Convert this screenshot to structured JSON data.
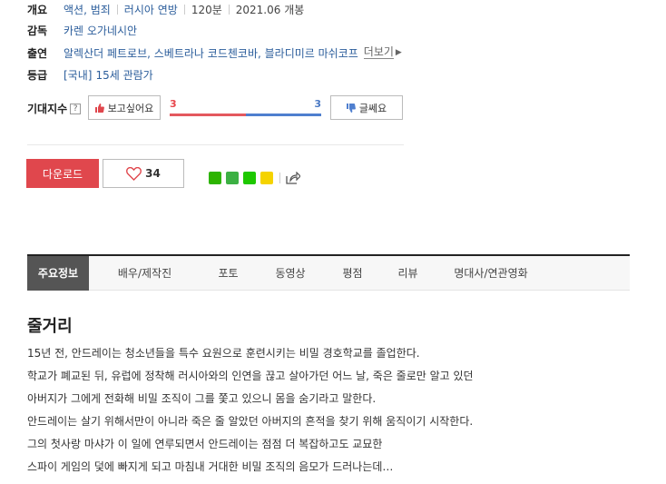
{
  "info": {
    "overview_label": "개요",
    "genre": "액션, 범죄",
    "country": "러시아 연방",
    "runtime": "120분",
    "release": "2021.06 개봉",
    "director_label": "감독",
    "director": "카렌 오가네시안",
    "cast_label": "출연",
    "cast": "알렉산더 페트로브, 스베트라나 코드첸코바, 블라디미르 마쉬코프",
    "more_label": "더보기",
    "rating_label": "등급",
    "rating_prefix": "[국내]",
    "rating": "15세 관람가"
  },
  "expect": {
    "label": "기대지수",
    "help": "?",
    "want_label": "보고싶어요",
    "meh_label": "글쎄요",
    "want_count": "3",
    "meh_count": "3",
    "want_share": 0.5
  },
  "actions": {
    "download_label": "다운로드",
    "like_count": "34"
  },
  "share": {
    "colors": [
      "#2db400",
      "#3cb043",
      "#1ec800",
      "#f5d300"
    ],
    "icons": [
      "band-icon",
      "line-icon",
      "bookmark-icon",
      "memo-icon"
    ]
  },
  "tabs": [
    "주요정보",
    "배우/제작진",
    "포토",
    "동영상",
    "평점",
    "리뷰",
    "명대사/연관영화"
  ],
  "synopsis": {
    "title": "줄거리",
    "lines": [
      "15년 전, 안드레이는 청소년들을 특수 요원으로 훈련시키는 비밀 경호학교를 졸업한다.",
      " 학교가 폐교된 뒤, 유럽에 정착해 러시아와의 인연을 끊고 살아가던 어느 날, 죽은 줄로만 알고 있던",
      " 아버지가 그에게 전화해 비밀 조직이 그를 쫓고 있으니 몸을 숨기라고 말한다.",
      " 안드레이는 살기 위해서만이 아니라 죽은 줄 알았던 아버지의 흔적을 찾기 위해 움직이기 시작한다.",
      " 그의 첫사랑 마샤가 이 일에 연루되면서 안드레이는 점점 더 복잡하고도 교묘한",
      " 스파이 게임의 덫에 빠지게 되고 마침내 거대한 비밀 조직의 음모가 드러나는데…"
    ]
  }
}
